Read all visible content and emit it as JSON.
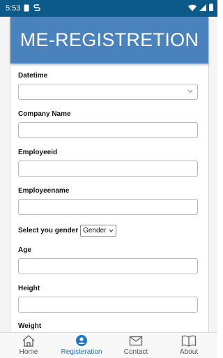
{
  "status": {
    "time": "5:53"
  },
  "header": {
    "title": "ME-REGISTRETION"
  },
  "form": {
    "datetime_label": "Datetime",
    "company_label": "Company Name",
    "employeeid_label": "Employeeid",
    "employeename_label": "Employeename",
    "gender_label": "Select you gender",
    "gender_value": "Gender",
    "age_label": "Age",
    "height_label": "Height",
    "weight_label": "Weight"
  },
  "nav": {
    "items": [
      {
        "label": "Home",
        "icon": "home-icon"
      },
      {
        "label": "Registeration",
        "icon": "person-icon",
        "active": true
      },
      {
        "label": "Contact",
        "icon": "mail-icon"
      },
      {
        "label": "About",
        "icon": "book-icon"
      }
    ]
  },
  "colors": {
    "status_bar": "#0b5a8a",
    "header": "#4a82bd",
    "active_tab": "#1e78c8"
  }
}
